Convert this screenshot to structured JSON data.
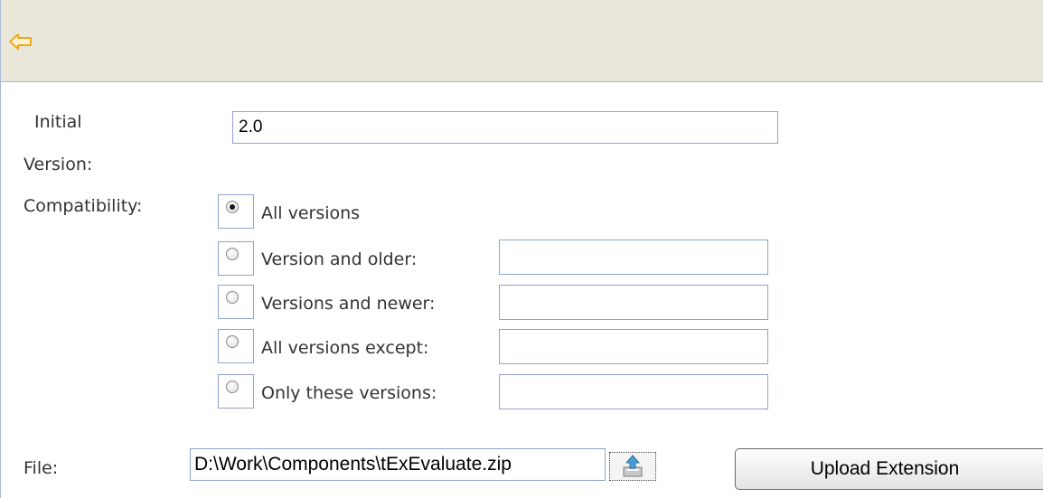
{
  "toolbar": {
    "back_icon": "arrow-left-icon",
    "accent": "#f2a81d"
  },
  "form": {
    "initial_version_label_line1": "Initial",
    "initial_version_label_line2": "Version:",
    "initial_version_value": "2.0",
    "compatibility_label": "Compatibility:",
    "options": [
      {
        "label": "All versions",
        "selected": true
      },
      {
        "label": "Version and older:",
        "selected": false,
        "value": ""
      },
      {
        "label": "Versions and newer:",
        "selected": false,
        "value": ""
      },
      {
        "label": "All versions except:",
        "selected": false,
        "value": ""
      },
      {
        "label": "Only these versions:",
        "selected": false,
        "value": ""
      }
    ],
    "file_label": "File:",
    "file_value": "D:\\Work\\Components\\tExEvaluate.zip",
    "browse_icon": "upload-file-icon",
    "upload_button_label": "Upload Extension"
  },
  "colors": {
    "toolbar_bg": "#e8e7da",
    "field_border": "#8fa3ce",
    "label_text": "#333333"
  }
}
